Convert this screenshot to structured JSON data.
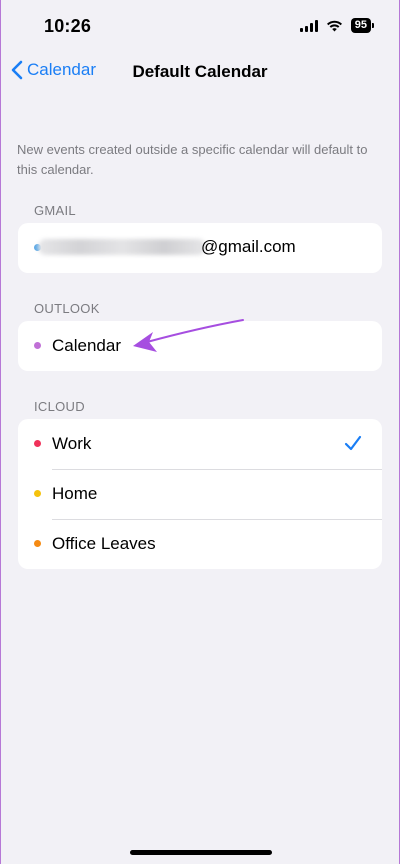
{
  "status": {
    "time": "10:26",
    "battery": "95",
    "icons": [
      "signal-icon",
      "wifi-icon",
      "battery-icon"
    ]
  },
  "nav": {
    "back_label": "Calendar",
    "title": "Default Calendar"
  },
  "description": "New events created outside a specific calendar will default to this calendar.",
  "sections": {
    "gmail": {
      "header": "GMAIL",
      "email_suffix": "@gmail.com",
      "dot_color": "#5aa8e6"
    },
    "outlook": {
      "header": "OUTLOOK",
      "items": [
        {
          "label": "Calendar",
          "dot_color": "#c070d6"
        }
      ]
    },
    "icloud": {
      "header": "ICLOUD",
      "items": [
        {
          "label": "Work",
          "dot_color": "#f0325a",
          "selected": true
        },
        {
          "label": "Home",
          "dot_color": "#f5c20c"
        },
        {
          "label": "Office Leaves",
          "dot_color": "#f58a12"
        }
      ]
    }
  },
  "colors": {
    "accent": "#1a7ef5",
    "annotation_arrow": "#a64ee0",
    "background": "#f2f1f6"
  }
}
